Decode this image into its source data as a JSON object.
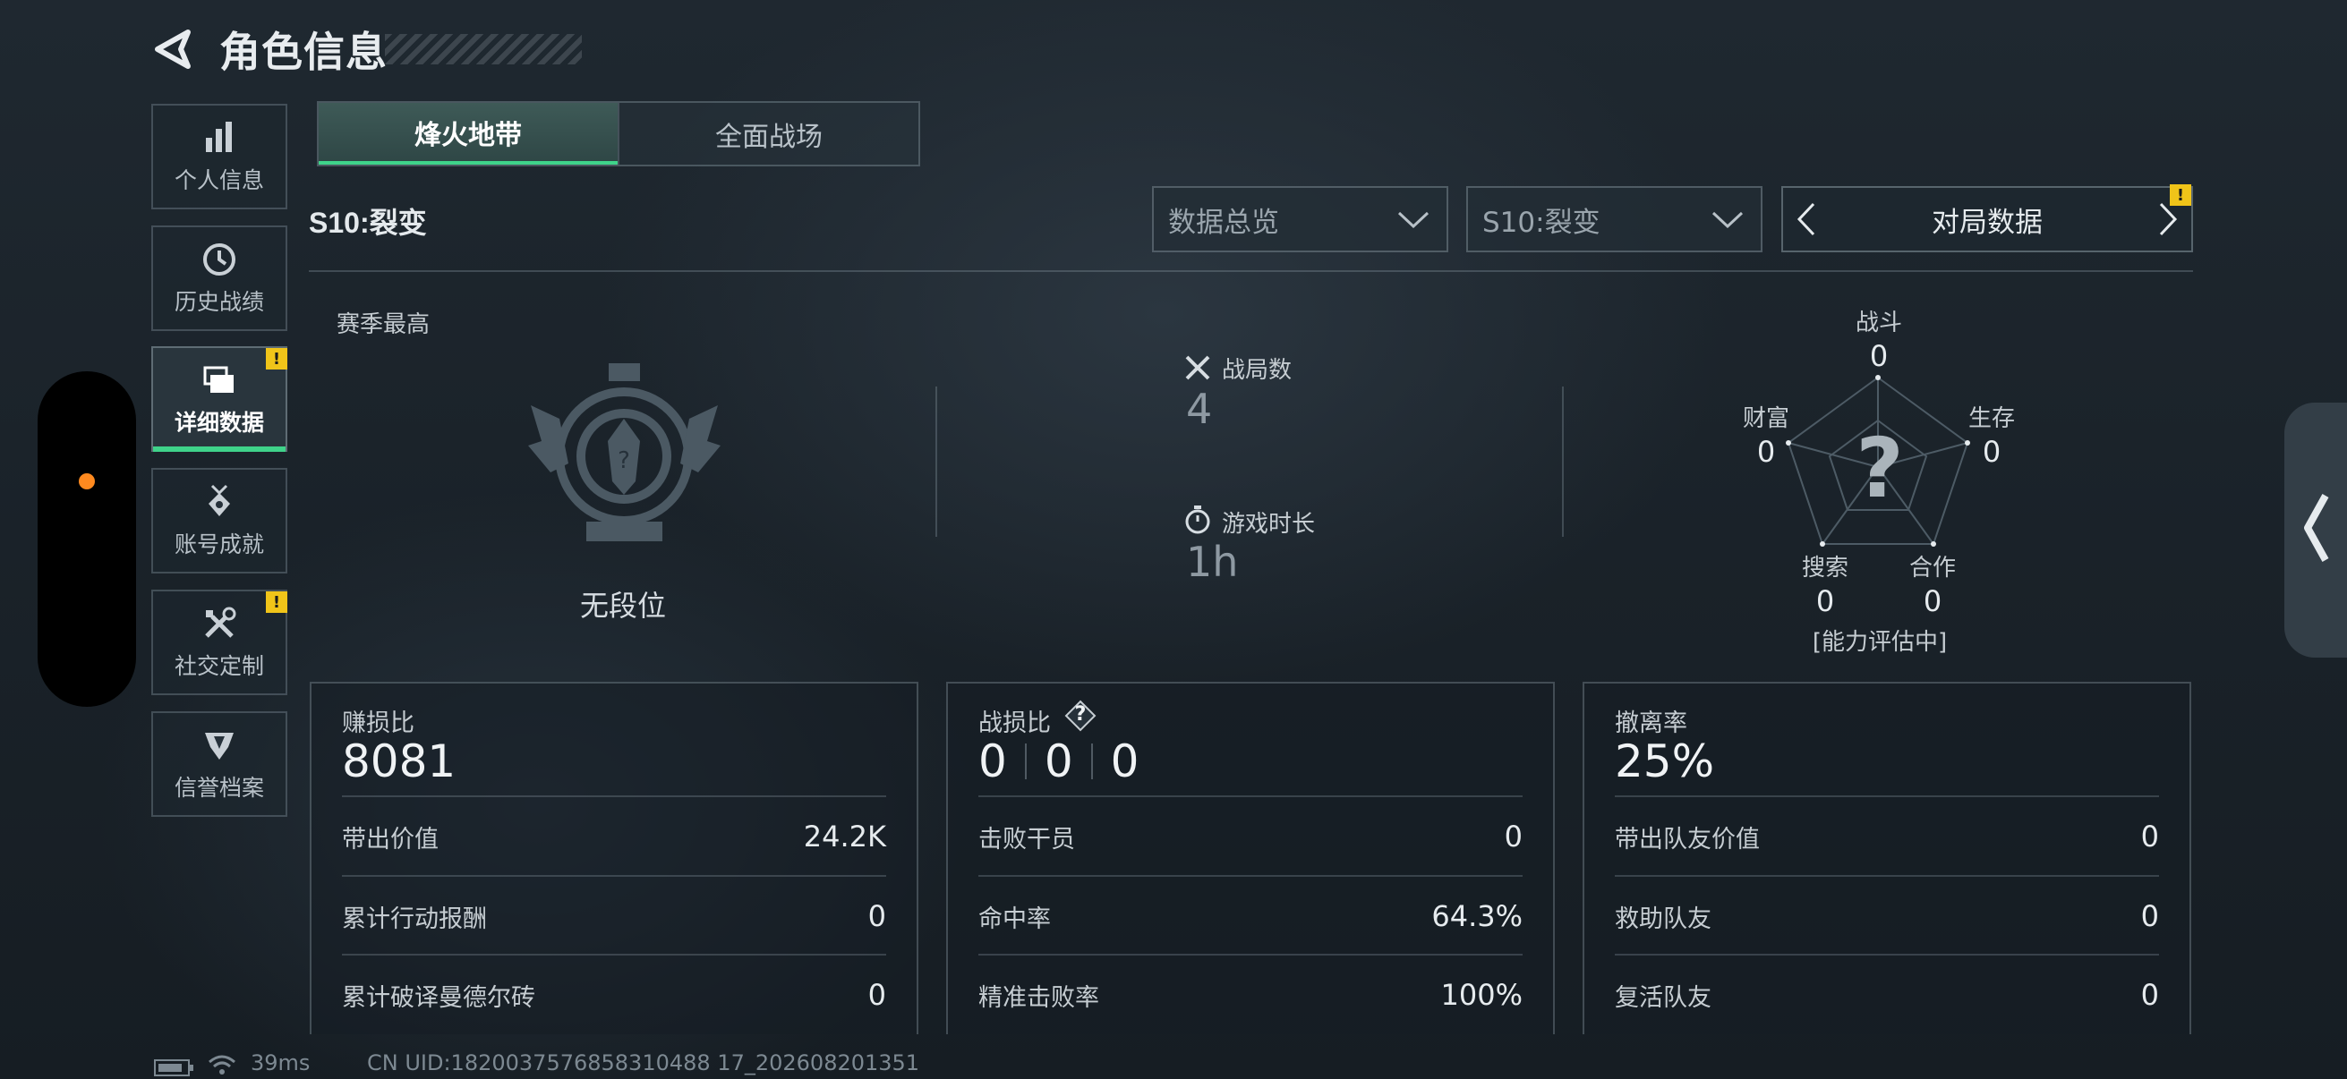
{
  "header": {
    "title": "角色信息"
  },
  "sidebar": {
    "items": [
      {
        "label": "个人信息",
        "icon": "bar-chart-icon"
      },
      {
        "label": "历史战绩",
        "icon": "history-clock-icon"
      },
      {
        "label": "详细数据",
        "icon": "stacked-cards-icon",
        "active": true,
        "badge": "!"
      },
      {
        "label": "账号成就",
        "icon": "medal-icon"
      },
      {
        "label": "社交定制",
        "icon": "tools-icon",
        "badge": "!"
      },
      {
        "label": "信誉档案",
        "icon": "shield-emblem-icon"
      }
    ]
  },
  "tabs": [
    {
      "label": "烽火地带",
      "active": true
    },
    {
      "label": "全面战场",
      "active": false
    }
  ],
  "season_label": "S10:裂变",
  "filters": {
    "overview": "数据总览",
    "season": "S10:裂变",
    "pager_label": "对局数据",
    "pager_badge": "!"
  },
  "rank": {
    "caption": "赛季最高",
    "name": "无段位"
  },
  "stats": {
    "matches_label": "战局数",
    "matches_value": "4",
    "playtime_label": "游戏时长",
    "playtime_value": "1h"
  },
  "radar": {
    "center_symbol": "?",
    "status": "[能力评估中]",
    "axes": [
      {
        "label": "战斗",
        "value": "0"
      },
      {
        "label": "生存",
        "value": "0"
      },
      {
        "label": "合作",
        "value": "0"
      },
      {
        "label": "搜索",
        "value": "0"
      },
      {
        "label": "财富",
        "value": "0"
      }
    ]
  },
  "cards": [
    {
      "label": "赚损比",
      "value": "8081",
      "rows": [
        {
          "k": "带出价值",
          "v": "24.2K"
        },
        {
          "k": "累计行动报酬",
          "v": "0"
        },
        {
          "k": "累计破译曼德尔砖",
          "v": "0"
        }
      ]
    },
    {
      "label": "战损比",
      "help": "?",
      "values": [
        "0",
        "0",
        "0"
      ],
      "rows": [
        {
          "k": "击败干员",
          "v": "0"
        },
        {
          "k": "命中率",
          "v": "64.3%"
        },
        {
          "k": "精准击败率",
          "v": "100%"
        }
      ]
    },
    {
      "label": "撤离率",
      "value": "25%",
      "rows": [
        {
          "k": "带出队友价值",
          "v": "0"
        },
        {
          "k": "救助队友",
          "v": "0"
        },
        {
          "k": "复活队友",
          "v": "0"
        }
      ]
    }
  ],
  "footer": {
    "ping": "39ms",
    "uid": "CN UID:1820037576858310488 17_202608201351"
  },
  "colors": {
    "accent": "#3fd38a",
    "warning": "#f0c419",
    "notification": "#ff8a1f"
  }
}
